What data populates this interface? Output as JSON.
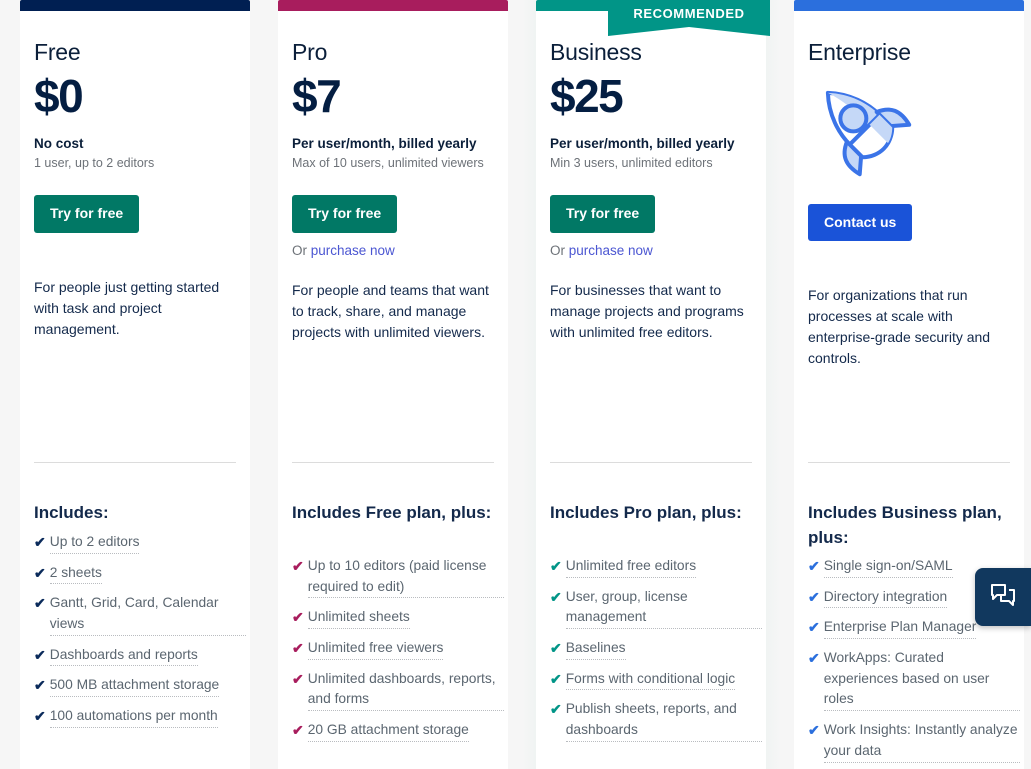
{
  "page": {
    "background_color": "#f6f6f6",
    "recommended_badge": "RECOMMENDED"
  },
  "chat": {
    "icon": "chat-bubbles-icon",
    "background_color": "#11385e"
  },
  "plans": [
    {
      "id": "free",
      "name": "Free",
      "price": "$0",
      "accent_color": "#001f52",
      "check_color": "#0b2b5b",
      "billing": "No cost",
      "billing_sub": "1 user, up to 2 editors",
      "cta_label": "Try for free",
      "cta_color": "#017865",
      "purchase_prefix": "",
      "purchase_link": "",
      "description": "For people just getting started with task and project management.",
      "includes_title": "Includes:",
      "features": [
        "Up to 2 editors",
        "2 sheets",
        "Gantt, Grid, Card, Calendar views",
        "Dashboards and reports",
        "500 MB attachment storage",
        "100 automations per month"
      ]
    },
    {
      "id": "pro",
      "name": "Pro",
      "price": "$7",
      "accent_color": "#a81d5d",
      "check_color": "#a81d5d",
      "billing": "Per user/month, billed yearly",
      "billing_sub": "Max of 10 users, unlimited viewers",
      "cta_label": "Try for free",
      "cta_color": "#017865",
      "purchase_prefix": "Or ",
      "purchase_link": "purchase now",
      "description": "For people and teams that want to track, share, and manage projects with unlimited viewers.",
      "includes_title": "Includes Free plan, plus:",
      "features": [
        "Up to 10 editors (paid license required to edit)",
        "Unlimited sheets",
        "Unlimited free viewers",
        "Unlimited dashboards, reports, and forms",
        "20 GB attachment storage"
      ]
    },
    {
      "id": "business",
      "name": "Business",
      "price": "$25",
      "accent_color": "#019587",
      "check_color": "#019587",
      "billing": "Per user/month, billed yearly",
      "billing_sub": "Min 3 users, unlimited editors",
      "cta_label": "Try for free",
      "cta_color": "#017865",
      "purchase_prefix": "Or ",
      "purchase_link": "purchase now",
      "description": "For businesses that want to manage projects and programs with unlimited free editors.",
      "includes_title": "Includes Pro plan, plus:",
      "features": [
        "Unlimited free editors",
        "User, group, license management",
        "Baselines",
        "Forms with conditional logic",
        "Publish sheets, reports, and dashboards"
      ]
    },
    {
      "id": "enterprise",
      "name": "Enterprise",
      "price": "",
      "accent_color": "#2b6fdd",
      "check_color": "#2b6fdd",
      "billing": "",
      "billing_sub": "",
      "cta_label": "Contact us",
      "cta_color": "#1a53d8",
      "purchase_prefix": "",
      "purchase_link": "",
      "description": "For organizations that run processes at scale with enterprise-grade security and controls.",
      "includes_title": "Includes Business plan, plus:",
      "features": [
        "Single sign-on/SAML",
        "Directory integration",
        "Enterprise Plan Manager",
        "WorkApps: Curated experiences based on user roles",
        "Work Insights: Instantly analyze your data"
      ]
    }
  ]
}
